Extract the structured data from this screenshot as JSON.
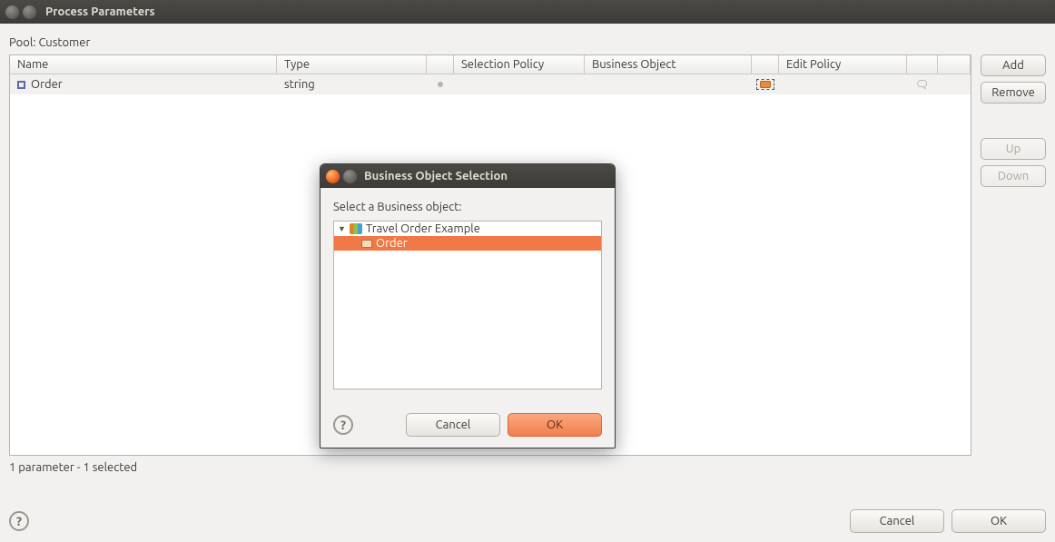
{
  "main": {
    "title": "Process Parameters",
    "pool_label": "Pool: Customer",
    "columns": {
      "name": "Name",
      "type": "Type",
      "selection_policy": "Selection Policy",
      "business_object": "Business Object",
      "edit_policy": "Edit Policy"
    },
    "rows": [
      {
        "name": "Order",
        "type": "string",
        "selection_policy": "",
        "business_object": "",
        "edit_policy": ""
      }
    ],
    "side_buttons": {
      "add": "Add",
      "remove": "Remove",
      "up": "Up",
      "down": "Down"
    },
    "status": "1 parameter - 1  selected",
    "footer": {
      "cancel": "Cancel",
      "ok": "OK"
    }
  },
  "modal": {
    "title": "Business Object Selection",
    "prompt": "Select a Business object:",
    "tree": {
      "root_label": "Travel Order Example",
      "child_label": "Order"
    },
    "footer": {
      "cancel": "Cancel",
      "ok": "OK"
    }
  }
}
